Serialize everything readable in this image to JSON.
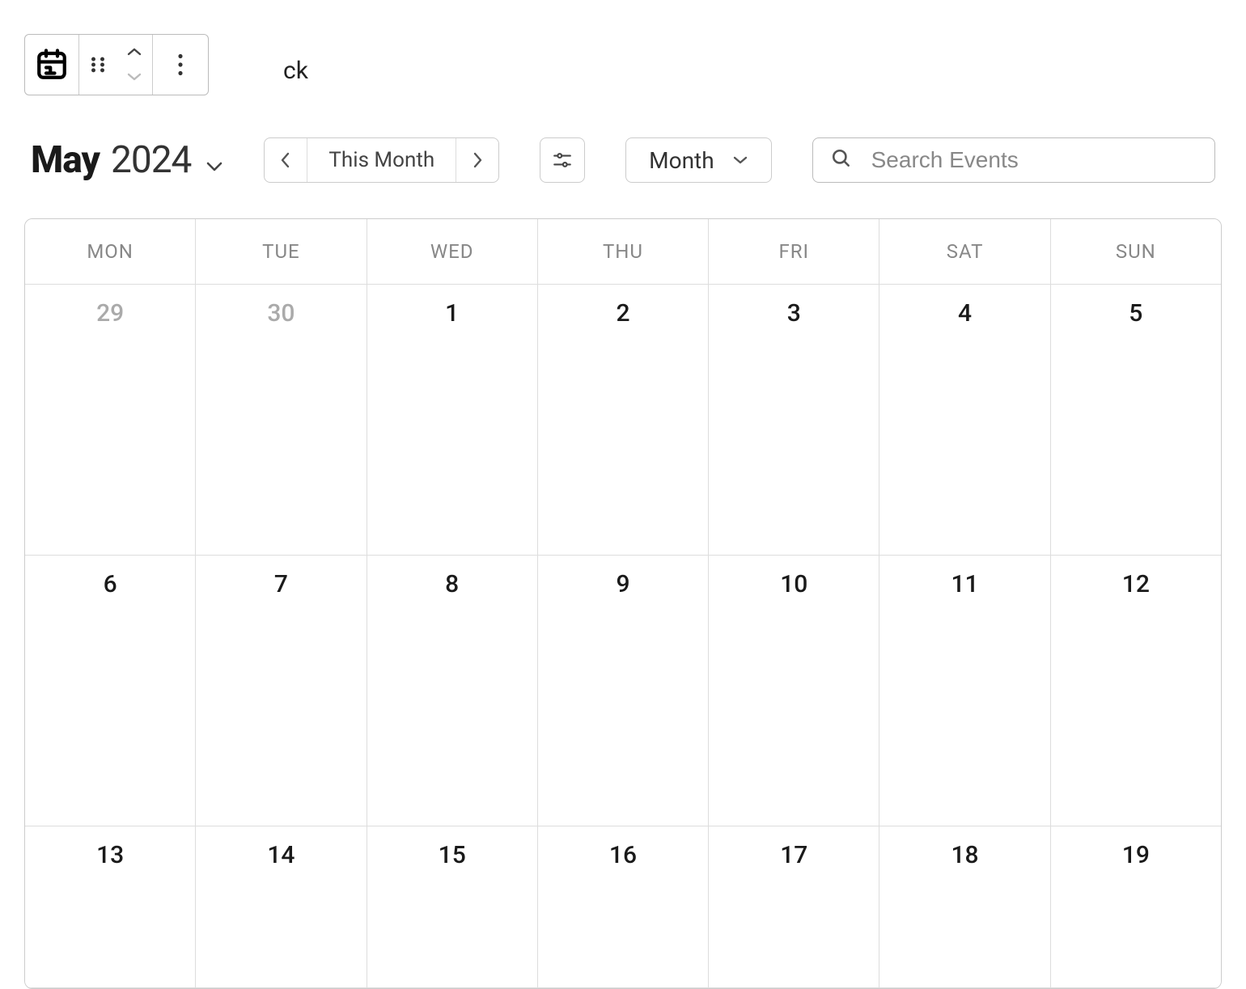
{
  "block_toolbar": {
    "trailing_text": "ck"
  },
  "title": {
    "month": "May",
    "year": "2024"
  },
  "nav": {
    "this_month_label": "This Month"
  },
  "view": {
    "selected": "Month"
  },
  "search": {
    "placeholder": "Search Events"
  },
  "weekdays": [
    "MON",
    "TUE",
    "WED",
    "THU",
    "FRI",
    "SAT",
    "SUN"
  ],
  "weeks": [
    [
      {
        "day": "29",
        "other": true
      },
      {
        "day": "30",
        "other": true
      },
      {
        "day": "1",
        "other": false
      },
      {
        "day": "2",
        "other": false
      },
      {
        "day": "3",
        "other": false
      },
      {
        "day": "4",
        "other": false
      },
      {
        "day": "5",
        "other": false
      }
    ],
    [
      {
        "day": "6",
        "other": false
      },
      {
        "day": "7",
        "other": false
      },
      {
        "day": "8",
        "other": false
      },
      {
        "day": "9",
        "other": false
      },
      {
        "day": "10",
        "other": false
      },
      {
        "day": "11",
        "other": false
      },
      {
        "day": "12",
        "other": false
      }
    ],
    [
      {
        "day": "13",
        "other": false
      },
      {
        "day": "14",
        "other": false
      },
      {
        "day": "15",
        "other": false
      },
      {
        "day": "16",
        "other": false
      },
      {
        "day": "17",
        "other": false
      },
      {
        "day": "18",
        "other": false
      },
      {
        "day": "19",
        "other": false
      }
    ]
  ]
}
